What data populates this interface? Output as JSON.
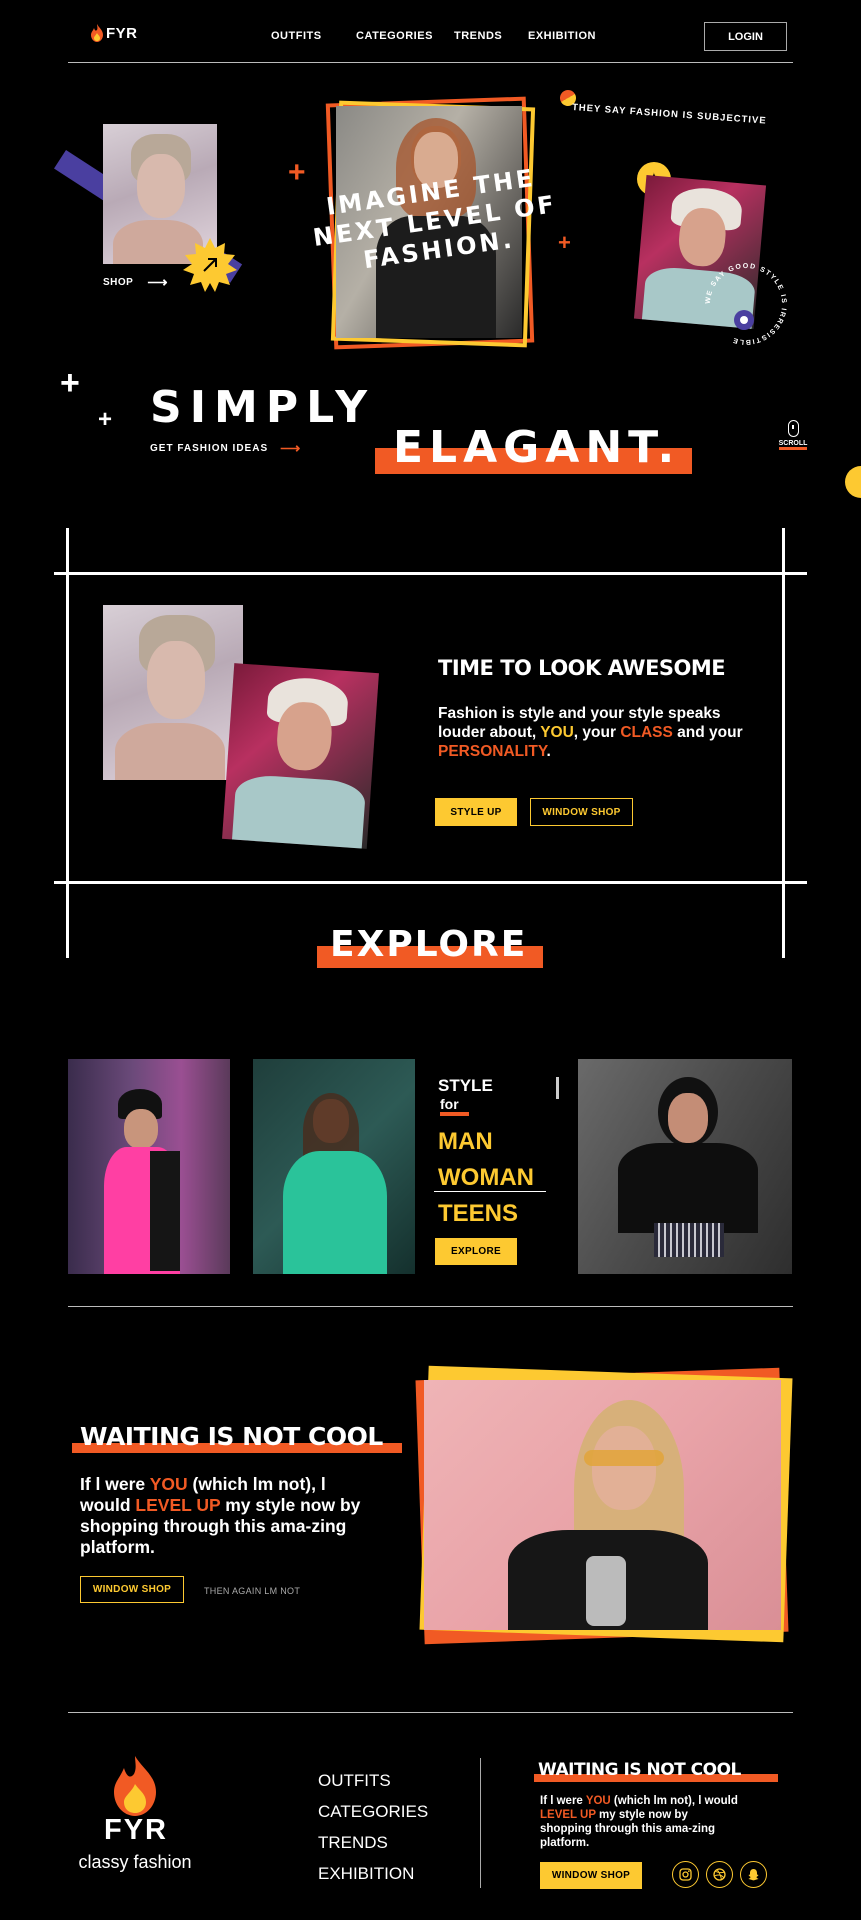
{
  "header": {
    "logo_text": "FYR",
    "nav": [
      "OUTFITS",
      "CATEGORIES",
      "TRENDS",
      "EXHIBITION"
    ],
    "login_label": "LOGIN"
  },
  "hero": {
    "shop_label": "SHOP",
    "tagline_curved": "THEY SAY FASHION IS SUBJECTIVE",
    "headline": [
      "IMAGINE THE",
      "NEXT LEVEL OF",
      "FASHION."
    ],
    "circle_text": "WE SAY GOOD STYLE IS IRRESISTIBLE",
    "simply": "SIMPLY",
    "elagant": "ELAGANT.",
    "get_ideas": "GET FASHION IDEAS",
    "scroll": "SCROLL"
  },
  "awesome": {
    "title": "TIME TO LOOK AWESOME",
    "text_1": "Fashion is style and your style speaks louder about, ",
    "you": "YOU",
    "text_2": ", your ",
    "class": "CLASS",
    "text_3": " and your ",
    "personality": "PERSONALITY",
    "text_4": ".",
    "style_up_label": "STYLE UP",
    "window_shop_label": "WINDOW SHOP"
  },
  "explore": {
    "title": "EXPLORE",
    "style": "STYLE",
    "for": "for",
    "categories": [
      "MAN",
      "WOMAN",
      "TEENS"
    ],
    "explore_button": "EXPLORE"
  },
  "waiting": {
    "title": "WAITING IS NOT COOL",
    "text_1": "If l were ",
    "you": "YOU",
    "text_2": " (which lm not), l would ",
    "level_up": "LEVEL UP",
    "text_3": " my style now by shopping through this ama-zing platform.",
    "window_shop_label": "WINDOW SHOP",
    "then_again": "THEN AGAIN LM NOT"
  },
  "footer": {
    "logo_text": "FYR",
    "slogan": "classy fashion",
    "nav": [
      "OUTFITS",
      "CATEGORIES",
      "TRENDS",
      "EXHIBITION"
    ],
    "title": "WAITING IS NOT COOL",
    "text_1": "If l were ",
    "you": "YOU",
    "text_2": " (which lm not), l would ",
    "level_up": "LEVEL UP",
    "text_3": " my style now by shopping through this ama-zing platform.",
    "window_shop_label": "WINDOW SHOP",
    "social_icons": [
      "instagram-icon",
      "dribbble-icon",
      "snapchat-icon"
    ]
  },
  "colors": {
    "accent_orange": "#f15a24",
    "accent_yellow": "#fdc931",
    "purple": "#4a3fa0",
    "background": "#000000"
  }
}
